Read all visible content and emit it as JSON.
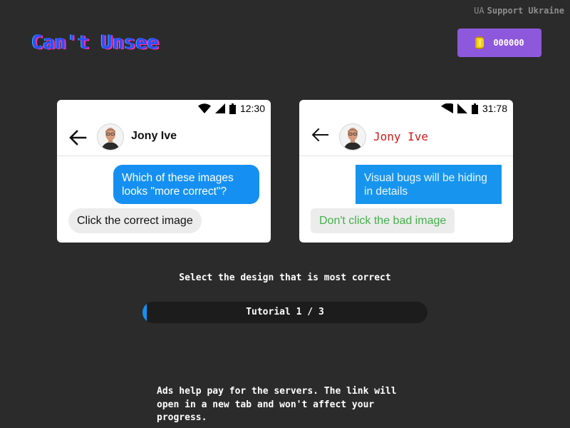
{
  "header": {
    "support_prefix": "UA",
    "support_label": "Support Ukraine",
    "logo_text": "Can't Unsee",
    "coins": "000000",
    "coin_icon": "coin-icon"
  },
  "cards": [
    {
      "status_time": "12:30",
      "status_icons": [
        "wifi-icon",
        "cellular-signal-icon",
        "battery-icon"
      ],
      "contact_name": "Jony Ive",
      "outgoing_message": "Which of these images looks \"more correct\"?",
      "incoming_message": "Click the correct image",
      "accent_color": "#1590f2"
    },
    {
      "status_time": "31:78",
      "status_icons": [
        "wifi-icon",
        "cellular-signal-icon",
        "battery-icon"
      ],
      "contact_name": "Jony Ive",
      "outgoing_message": "Visual bugs will be hiding in details",
      "incoming_message": "Don't click the bad image",
      "accent_color": "#1795ee",
      "name_color": "#d11a1a",
      "incoming_text_color": "#43b04a"
    }
  ],
  "game": {
    "instruction": "Select the design that is most correct",
    "progress_label": "Tutorial 1 / 3",
    "progress_fraction": 0.01
  },
  "footer": {
    "ad_note": "Ads help pay for the servers. The link will open in a new tab and won't affect your progress."
  },
  "colors": {
    "background": "#2b2b2b",
    "coin_button": "#8e58dd",
    "progress_track": "#1c1c1c",
    "progress_fill": "#1590f2"
  }
}
